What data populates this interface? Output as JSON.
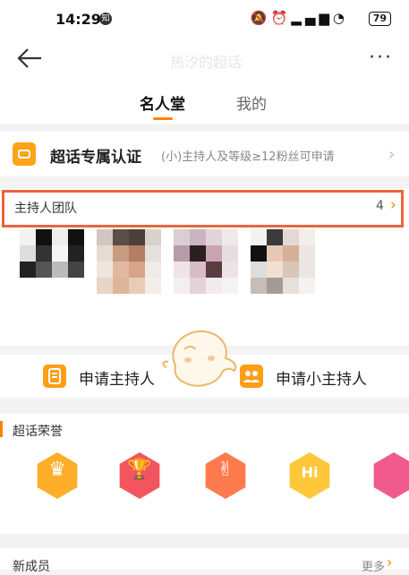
{
  "status_bar": {
    "time": "14:29",
    "notification_badge": "知",
    "battery": "79",
    "icons": [
      "mute-bell-icon",
      "alarm-icon",
      "signal-icon",
      "wifi-icon"
    ]
  },
  "header": {
    "title": "热汐的超话"
  },
  "tabs": [
    {
      "label": "名人堂",
      "active": true
    },
    {
      "label": "我的",
      "active": false
    }
  ],
  "certification": {
    "title": "超话专属认证",
    "subtitle": "(小)主持人及等级≥12粉丝可申请"
  },
  "host_team": {
    "title": "主持人团队",
    "count": "4"
  },
  "apply": {
    "host_label": "申请主持人",
    "minor_host_label": "申请小主持人"
  },
  "honor": {
    "title": "超话荣誉",
    "badges": [
      {
        "icon": "crown-icon",
        "color": "#ffae2a"
      },
      {
        "icon": "trophy-icon",
        "color": "#f2555d"
      },
      {
        "icon": "hand-icon",
        "color": "#ff7a4d"
      },
      {
        "icon": "hi-icon",
        "color": "#ffc83a"
      },
      {
        "icon": "gift-icon",
        "color": "#f05a8c"
      }
    ]
  },
  "new_members": {
    "title": "新成员",
    "more_label": "更多"
  },
  "colors": {
    "accent": "#ff8200",
    "highlight_border": "#e8663a"
  }
}
